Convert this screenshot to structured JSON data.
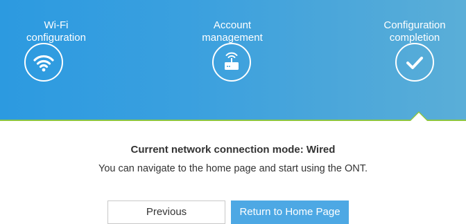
{
  "steps": [
    {
      "label_line1": "Wi-Fi",
      "label_line2": "configuration",
      "icon": "wifi-icon"
    },
    {
      "label_line1": "Account",
      "label_line2": "management",
      "icon": "router-icon"
    },
    {
      "label_line1": "Configuration",
      "label_line2": "completion",
      "icon": "checkmark-icon"
    }
  ],
  "content": {
    "title": "Current network connection mode: Wired",
    "description": "You can navigate to the home page and start using the ONT."
  },
  "buttons": {
    "previous": "Previous",
    "home": "Return to Home Page"
  },
  "colors": {
    "header_blue": "#3aa0df",
    "progress_green": "#8dc63f",
    "primary_button": "#4da8e4"
  }
}
